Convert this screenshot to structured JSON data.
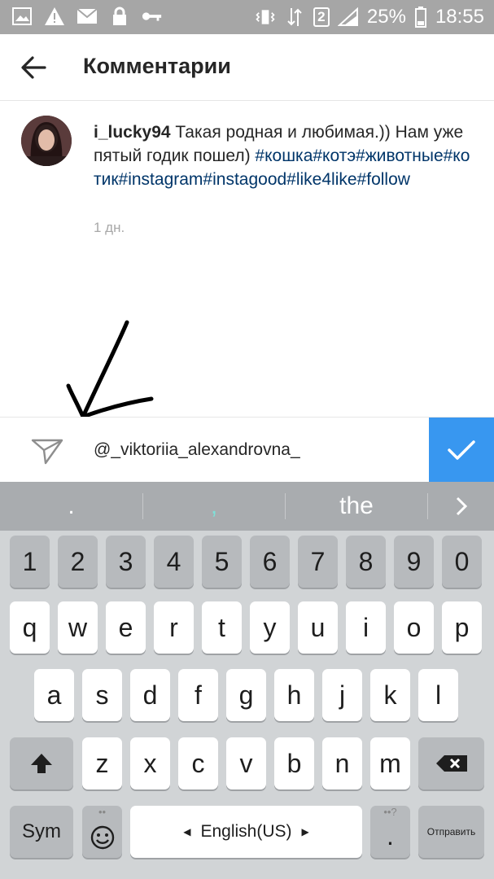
{
  "status_bar": {
    "battery_percent": "25%",
    "time": "18:55",
    "sim_badge": "2"
  },
  "header": {
    "title": "Комментарии"
  },
  "comment": {
    "username": "i_lucky94",
    "text": "Такая родная и любимая.)) Нам уже пятый годик пошел)",
    "hashtags": "#кошка#котэ#животные#котик#instagram#instagood#like4like#follow",
    "time": "1 дн."
  },
  "input": {
    "value": "@_viktoriia_alexandrovna_"
  },
  "keyboard": {
    "suggestions": [
      ".",
      ",",
      "the"
    ],
    "number_row": [
      "1",
      "2",
      "3",
      "4",
      "5",
      "6",
      "7",
      "8",
      "9",
      "0"
    ],
    "row1": [
      "q",
      "w",
      "e",
      "r",
      "t",
      "y",
      "u",
      "i",
      "o",
      "p"
    ],
    "row2": [
      "a",
      "s",
      "d",
      "f",
      "g",
      "h",
      "j",
      "k",
      "l"
    ],
    "row3": [
      "z",
      "x",
      "c",
      "v",
      "b",
      "n",
      "m"
    ],
    "sym_label": "Sym",
    "space_label": "English(US)",
    "send_label": "Отправить",
    "mic_hint": "••",
    "period_key": ".",
    "period_hint": "••?"
  },
  "colors": {
    "accent": "#3897f0",
    "hashtag": "#003569",
    "status_bar": "#a6a6a6",
    "keyboard_bg": "#d1d4d6"
  }
}
